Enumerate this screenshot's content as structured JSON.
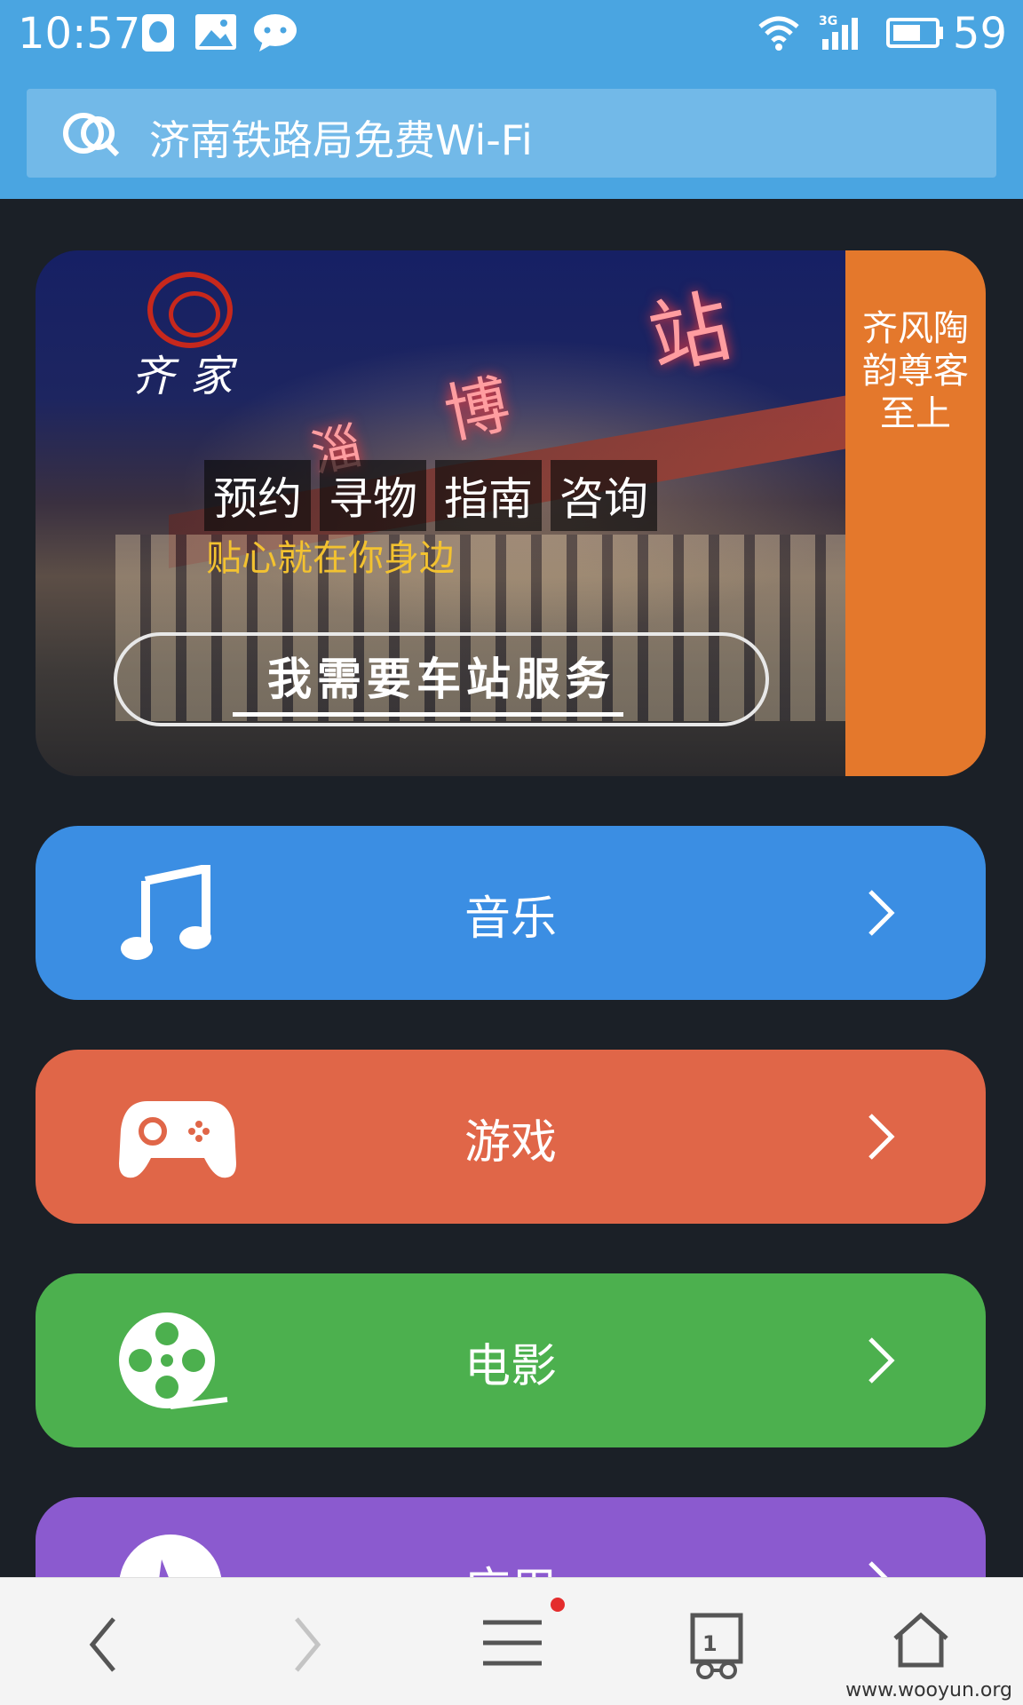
{
  "status_bar": {
    "time": "10:57",
    "battery_percent": "59",
    "network": "3G",
    "icons": [
      "qq-icon",
      "gallery-icon",
      "wechat-icon",
      "wifi-icon",
      "signal-icon",
      "battery-icon"
    ]
  },
  "address_bar": {
    "title": "济南铁路局免费Wi-Fi",
    "icon": "wifi-brand-icon"
  },
  "banner": {
    "logo_text": "齐家",
    "sign_chars": [
      "站",
      "博",
      "淄"
    ],
    "service_tags": [
      "预约",
      "寻物",
      "指南",
      "咨询"
    ],
    "tagline": "贴心就在你身边",
    "cta_label": "我需要车站服务",
    "side_text": "齐风陶韵尊客至上",
    "accent_color": "#e4782c"
  },
  "categories": [
    {
      "label": "音乐",
      "icon": "music-note-icon",
      "color": "#3b8ee3"
    },
    {
      "label": "游戏",
      "icon": "gamepad-icon",
      "color": "#e06648"
    },
    {
      "label": "电影",
      "icon": "film-reel-icon",
      "color": "#4cb04e"
    },
    {
      "label": "应用",
      "icon": "app-icon",
      "color": "#8b5acf"
    }
  ],
  "bottom_nav": {
    "tab_count": "1",
    "items": [
      "back-icon",
      "forward-icon",
      "menu-icon",
      "tabs-icon",
      "home-icon"
    ]
  },
  "watermark": "www.wooyun.org"
}
